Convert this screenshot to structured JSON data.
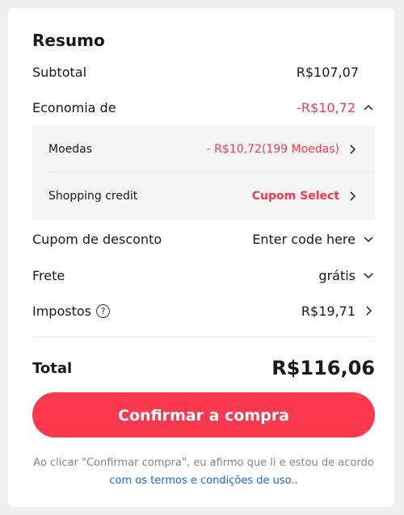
{
  "summary": {
    "title": "Resumo",
    "subtotal_label": "Subtotal",
    "subtotal_value": "R$107,07",
    "savings_label": "Economia de",
    "savings_value": "-R$10,72",
    "savings_details": {
      "coins_label": "Moedas",
      "coins_value": "- R$10,72(199 Moedas)",
      "credit_label": "Shopping credit",
      "credit_value": "Cupom Select"
    },
    "coupon_label": "Cupom de desconto",
    "coupon_value": "Enter code here",
    "shipping_label": "Frete",
    "shipping_value": "grátis",
    "taxes_label": "Impostos",
    "taxes_help_symbol": "?",
    "taxes_value": "R$19,71",
    "total_label": "Total",
    "total_value": "R$116,06"
  },
  "actions": {
    "confirm_label": "Confirmar a compra"
  },
  "disclaimer": {
    "text": "Ao clicar \"Confirmar compra\", eu afirmo que li e estou de acordo ",
    "link_text": "com os termos e condições de uso.."
  },
  "colors": {
    "accent": "#fd384f",
    "link": "#1768d8",
    "background": "#efefef"
  },
  "icons": {
    "savings_toggle": "chevron-up-icon",
    "row_arrow": "chevron-right-icon",
    "dropdown": "chevron-down-icon",
    "help": "question-circle-icon"
  }
}
